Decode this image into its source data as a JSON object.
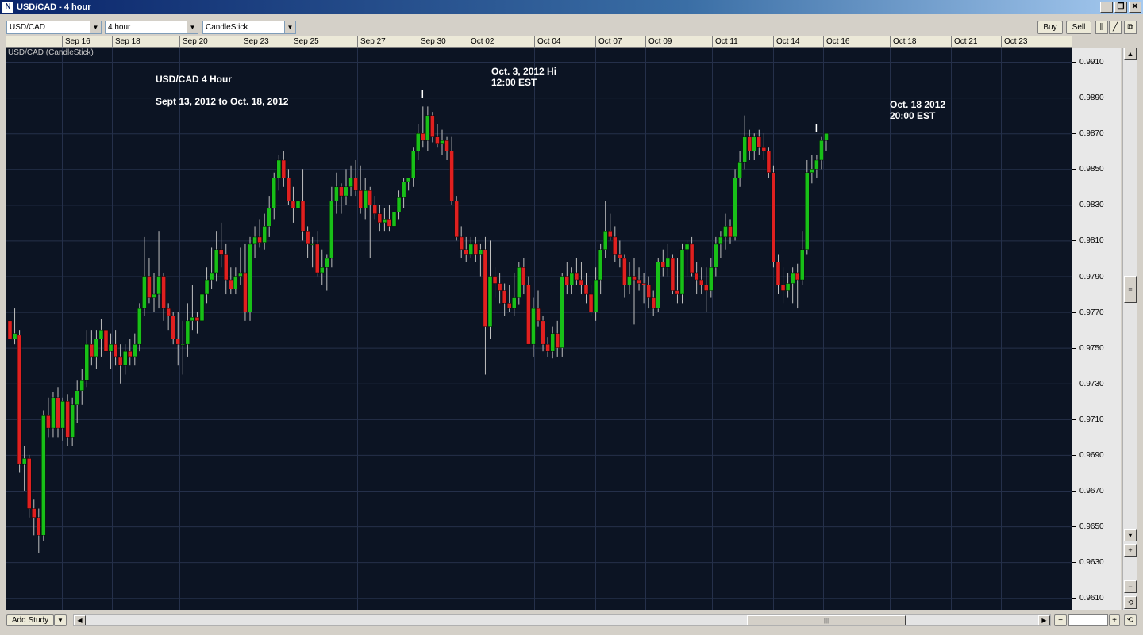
{
  "window": {
    "title": "USD/CAD - 4 hour",
    "icon": "app-logo-icon"
  },
  "toolbar": {
    "symbol": "USD/CAD",
    "interval": "4 hour",
    "chart_style": "CandleStick",
    "buy_label": "Buy",
    "sell_label": "Sell"
  },
  "chart_label": "USD/CAD (CandleStick)",
  "annotations": {
    "title_line1": "USD/CAD 4 Hour",
    "title_line2": "Sept 13, 2012 to Oct. 18, 2012",
    "high_line1": "Oct. 3, 2012 Hi",
    "high_line2": "12:00 EST",
    "last_line1": "Oct. 18 2012",
    "last_line2": "20:00 EST"
  },
  "bottom": {
    "add_study_label": "Add Study"
  },
  "colors": {
    "background": "#0c1423",
    "grid": "#25304a",
    "bull": "#18c018",
    "bear": "#e02020",
    "wick": "#bfbfbf"
  },
  "chart_data": {
    "type": "candlestick",
    "title": "USD/CAD 4 Hour",
    "subtitle": "Sept 13, 2012 to Oct. 18, 2012",
    "x_ticks": [
      "Sep 16",
      "Sep 18",
      "Sep 20",
      "Sep 23",
      "Sep 25",
      "Sep 27",
      "Sep 30",
      "Oct 02",
      "Oct 04",
      "Oct 07",
      "Oct 09",
      "Oct 11",
      "Oct 14",
      "Oct 16",
      "Oct 18",
      "Oct 21",
      "Oct 23"
    ],
    "y_ticks": [
      "0.9910",
      "0.9890",
      "0.9870",
      "0.9850",
      "0.9830",
      "0.9810",
      "0.9790",
      "0.9770",
      "0.9750",
      "0.9730",
      "0.9710",
      "0.9690",
      "0.9670",
      "0.9650",
      "0.9630",
      "0.9610"
    ],
    "ylim": [
      0.9603,
      0.9918
    ],
    "grid": true,
    "ohlc": [
      [
        0.9765,
        0.9775,
        0.9755,
        0.9755
      ],
      [
        0.9755,
        0.9772,
        0.9752,
        0.9758
      ],
      [
        0.9757,
        0.976,
        0.968,
        0.9685
      ],
      [
        0.9685,
        0.9695,
        0.967,
        0.9688
      ],
      [
        0.9688,
        0.969,
        0.9655,
        0.966
      ],
      [
        0.966,
        0.9665,
        0.9645,
        0.9655
      ],
      [
        0.9655,
        0.966,
        0.9635,
        0.9645
      ],
      [
        0.9645,
        0.9715,
        0.9642,
        0.9712
      ],
      [
        0.9712,
        0.9722,
        0.97,
        0.9705
      ],
      [
        0.9705,
        0.9725,
        0.97,
        0.9722
      ],
      [
        0.9722,
        0.9728,
        0.97,
        0.9705
      ],
      [
        0.9705,
        0.9722,
        0.9698,
        0.972
      ],
      [
        0.972,
        0.9724,
        0.9695,
        0.97
      ],
      [
        0.97,
        0.9722,
        0.9695,
        0.9718
      ],
      [
        0.9718,
        0.9732,
        0.9708,
        0.9726
      ],
      [
        0.9726,
        0.9738,
        0.9718,
        0.9732
      ],
      [
        0.9732,
        0.976,
        0.9728,
        0.9752
      ],
      [
        0.9752,
        0.976,
        0.974,
        0.9745
      ],
      [
        0.9745,
        0.976,
        0.9738,
        0.9755
      ],
      [
        0.9755,
        0.9766,
        0.9745,
        0.976
      ],
      [
        0.976,
        0.9762,
        0.974,
        0.9748
      ],
      [
        0.9748,
        0.9758,
        0.9738,
        0.9752
      ],
      [
        0.9752,
        0.976,
        0.974,
        0.9745
      ],
      [
        0.9745,
        0.9752,
        0.973,
        0.974
      ],
      [
        0.974,
        0.9752,
        0.9735,
        0.9748
      ],
      [
        0.9748,
        0.9755,
        0.974,
        0.9745
      ],
      [
        0.9745,
        0.9758,
        0.974,
        0.9752
      ],
      [
        0.9752,
        0.9775,
        0.9748,
        0.9772
      ],
      [
        0.9772,
        0.9812,
        0.9768,
        0.979
      ],
      [
        0.979,
        0.98,
        0.9775,
        0.9778
      ],
      [
        0.9778,
        0.9792,
        0.977,
        0.978
      ],
      [
        0.978,
        0.9815,
        0.9772,
        0.979
      ],
      [
        0.979,
        0.9792,
        0.9765,
        0.9772
      ],
      [
        0.9772,
        0.9775,
        0.976,
        0.9768
      ],
      [
        0.9768,
        0.977,
        0.9752,
        0.9755
      ],
      [
        0.9755,
        0.977,
        0.974,
        0.9752
      ],
      [
        0.9752,
        0.9765,
        0.9735,
        0.9752
      ],
      [
        0.9752,
        0.9775,
        0.9745,
        0.9765
      ],
      [
        0.9765,
        0.9785,
        0.976,
        0.9767
      ],
      [
        0.9767,
        0.977,
        0.9758,
        0.9765
      ],
      [
        0.9765,
        0.9782,
        0.976,
        0.978
      ],
      [
        0.978,
        0.9795,
        0.9775,
        0.9788
      ],
      [
        0.9788,
        0.9806,
        0.9783,
        0.9792
      ],
      [
        0.9792,
        0.9815,
        0.9787,
        0.9805
      ],
      [
        0.9805,
        0.982,
        0.9795,
        0.9802
      ],
      [
        0.9802,
        0.9808,
        0.978,
        0.9788
      ],
      [
        0.9788,
        0.9795,
        0.978,
        0.9783
      ],
      [
        0.9783,
        0.9795,
        0.978,
        0.979
      ],
      [
        0.979,
        0.9806,
        0.9785,
        0.9792
      ],
      [
        0.9792,
        0.9808,
        0.9765,
        0.977
      ],
      [
        0.977,
        0.9812,
        0.9765,
        0.9808
      ],
      [
        0.9808,
        0.9818,
        0.98,
        0.9812
      ],
      [
        0.9812,
        0.9822,
        0.9806,
        0.9809
      ],
      [
        0.9809,
        0.9825,
        0.9805,
        0.9818
      ],
      [
        0.9818,
        0.9835,
        0.9812,
        0.9828
      ],
      [
        0.9828,
        0.9848,
        0.9822,
        0.9845
      ],
      [
        0.9845,
        0.9858,
        0.9838,
        0.9855
      ],
      [
        0.9855,
        0.986,
        0.984,
        0.9845
      ],
      [
        0.9845,
        0.985,
        0.983,
        0.9832
      ],
      [
        0.9832,
        0.984,
        0.982,
        0.9828
      ],
      [
        0.9828,
        0.9845,
        0.9825,
        0.9832
      ],
      [
        0.9832,
        0.985,
        0.981,
        0.9815
      ],
      [
        0.9815,
        0.9818,
        0.98,
        0.9808
      ],
      [
        0.9808,
        0.9812,
        0.9795,
        0.9808
      ],
      [
        0.9808,
        0.9815,
        0.979,
        0.9792
      ],
      [
        0.9792,
        0.9805,
        0.9785,
        0.9795
      ],
      [
        0.9795,
        0.9802,
        0.9782,
        0.98
      ],
      [
        0.98,
        0.984,
        0.9795,
        0.9832
      ],
      [
        0.9832,
        0.9848,
        0.9825,
        0.984
      ],
      [
        0.984,
        0.9842,
        0.9825,
        0.9835
      ],
      [
        0.9835,
        0.985,
        0.983,
        0.984
      ],
      [
        0.984,
        0.9852,
        0.9835,
        0.9845
      ],
      [
        0.9845,
        0.9855,
        0.9835,
        0.9838
      ],
      [
        0.9838,
        0.9852,
        0.9825,
        0.9828
      ],
      [
        0.9828,
        0.9845,
        0.9822,
        0.9838
      ],
      [
        0.9838,
        0.984,
        0.98,
        0.983
      ],
      [
        0.983,
        0.9835,
        0.9822,
        0.9825
      ],
      [
        0.9825,
        0.983,
        0.9815,
        0.982
      ],
      [
        0.982,
        0.9828,
        0.9815,
        0.9822
      ],
      [
        0.9822,
        0.983,
        0.9815,
        0.9818
      ],
      [
        0.9818,
        0.9832,
        0.9812,
        0.9826
      ],
      [
        0.9826,
        0.9838,
        0.9822,
        0.9834
      ],
      [
        0.9834,
        0.9845,
        0.9828,
        0.9843
      ],
      [
        0.9843,
        0.9845,
        0.9838,
        0.9845
      ],
      [
        0.9845,
        0.9862,
        0.984,
        0.986
      ],
      [
        0.986,
        0.9875,
        0.9855,
        0.987
      ],
      [
        0.987,
        0.9885,
        0.9862,
        0.9866
      ],
      [
        0.9866,
        0.9885,
        0.986,
        0.988
      ],
      [
        0.988,
        0.9882,
        0.9865,
        0.9868
      ],
      [
        0.9868,
        0.9875,
        0.9862,
        0.9864
      ],
      [
        0.9864,
        0.9872,
        0.9858,
        0.9866
      ],
      [
        0.9866,
        0.9868,
        0.9855,
        0.986
      ],
      [
        0.986,
        0.9868,
        0.983,
        0.9832
      ],
      [
        0.9832,
        0.9835,
        0.981,
        0.9812
      ],
      [
        0.9812,
        0.9818,
        0.98,
        0.9805
      ],
      [
        0.9805,
        0.9812,
        0.9798,
        0.9802
      ],
      [
        0.9802,
        0.9812,
        0.98,
        0.9808
      ],
      [
        0.9808,
        0.9812,
        0.9798,
        0.9802
      ],
      [
        0.9802,
        0.9808,
        0.979,
        0.9805
      ],
      [
        0.9805,
        0.9812,
        0.9735,
        0.9762
      ],
      [
        0.9762,
        0.981,
        0.9755,
        0.979
      ],
      [
        0.979,
        0.9795,
        0.9778,
        0.9786
      ],
      [
        0.9786,
        0.9792,
        0.9775,
        0.9782
      ],
      [
        0.9782,
        0.9786,
        0.9768,
        0.9775
      ],
      [
        0.9775,
        0.9785,
        0.977,
        0.9772
      ],
      [
        0.9772,
        0.9792,
        0.9768,
        0.9778
      ],
      [
        0.9778,
        0.9798,
        0.9774,
        0.9795
      ],
      [
        0.9795,
        0.98,
        0.978,
        0.9785
      ],
      [
        0.9785,
        0.979,
        0.9752,
        0.9752
      ],
      [
        0.9752,
        0.9778,
        0.9745,
        0.9772
      ],
      [
        0.9772,
        0.9782,
        0.9762,
        0.9765
      ],
      [
        0.9765,
        0.9768,
        0.9748,
        0.9752
      ],
      [
        0.9752,
        0.9756,
        0.9745,
        0.9748
      ],
      [
        0.9748,
        0.9762,
        0.9744,
        0.9758
      ],
      [
        0.9758,
        0.9765,
        0.9745,
        0.975
      ],
      [
        0.975,
        0.9792,
        0.9745,
        0.979
      ],
      [
        0.979,
        0.9798,
        0.978,
        0.9785
      ],
      [
        0.9785,
        0.9795,
        0.978,
        0.9792
      ],
      [
        0.9792,
        0.98,
        0.9785,
        0.9788
      ],
      [
        0.9788,
        0.9798,
        0.978,
        0.9785
      ],
      [
        0.9785,
        0.9792,
        0.9775,
        0.978
      ],
      [
        0.978,
        0.9785,
        0.9768,
        0.977
      ],
      [
        0.977,
        0.9795,
        0.9765,
        0.9788
      ],
      [
        0.9788,
        0.9808,
        0.978,
        0.9805
      ],
      [
        0.9805,
        0.9832,
        0.98,
        0.9815
      ],
      [
        0.9815,
        0.9825,
        0.981,
        0.9812
      ],
      [
        0.9812,
        0.9818,
        0.9798,
        0.9802
      ],
      [
        0.9802,
        0.981,
        0.9795,
        0.98
      ],
      [
        0.98,
        0.9802,
        0.9778,
        0.9785
      ],
      [
        0.9785,
        0.9798,
        0.978,
        0.979
      ],
      [
        0.979,
        0.98,
        0.9763,
        0.9788
      ],
      [
        0.9788,
        0.9795,
        0.9782,
        0.9786
      ],
      [
        0.9786,
        0.9792,
        0.9775,
        0.9785
      ],
      [
        0.9785,
        0.979,
        0.9772,
        0.9778
      ],
      [
        0.9778,
        0.9782,
        0.9768,
        0.9772
      ],
      [
        0.9772,
        0.98,
        0.977,
        0.9798
      ],
      [
        0.9798,
        0.9805,
        0.979,
        0.9795
      ],
      [
        0.9795,
        0.9808,
        0.979,
        0.98
      ],
      [
        0.98,
        0.9802,
        0.978,
        0.9782
      ],
      [
        0.9782,
        0.98,
        0.9775,
        0.978
      ],
      [
        0.978,
        0.9808,
        0.9775,
        0.9805
      ],
      [
        0.9805,
        0.981,
        0.979,
        0.9808
      ],
      [
        0.9808,
        0.9812,
        0.979,
        0.9792
      ],
      [
        0.9792,
        0.9798,
        0.978,
        0.9788
      ],
      [
        0.9788,
        0.9795,
        0.978,
        0.9785
      ],
      [
        0.9785,
        0.9795,
        0.977,
        0.9782
      ],
      [
        0.9782,
        0.98,
        0.9778,
        0.9795
      ],
      [
        0.9795,
        0.9812,
        0.979,
        0.9808
      ],
      [
        0.9808,
        0.9815,
        0.98,
        0.9812
      ],
      [
        0.9812,
        0.9825,
        0.9805,
        0.9818
      ],
      [
        0.9818,
        0.9822,
        0.9808,
        0.9812
      ],
      [
        0.9812,
        0.985,
        0.981,
        0.9845
      ],
      [
        0.9845,
        0.986,
        0.984,
        0.9854
      ],
      [
        0.9854,
        0.988,
        0.985,
        0.9868
      ],
      [
        0.9868,
        0.9872,
        0.9855,
        0.986
      ],
      [
        0.986,
        0.987,
        0.9855,
        0.9868
      ],
      [
        0.9868,
        0.9872,
        0.9858,
        0.9862
      ],
      [
        0.9862,
        0.987,
        0.9855,
        0.986
      ],
      [
        0.986,
        0.9862,
        0.9845,
        0.9848
      ],
      [
        0.9848,
        0.9852,
        0.9795,
        0.9798
      ],
      [
        0.9798,
        0.9802,
        0.978,
        0.9785
      ],
      [
        0.9785,
        0.9795,
        0.9775,
        0.9782
      ],
      [
        0.9782,
        0.9792,
        0.9778,
        0.9786
      ],
      [
        0.9786,
        0.9795,
        0.9775,
        0.9792
      ],
      [
        0.9792,
        0.9797,
        0.9772,
        0.9788
      ],
      [
        0.9788,
        0.9815,
        0.9785,
        0.9805
      ],
      [
        0.9805,
        0.9855,
        0.9802,
        0.9848
      ],
      [
        0.9848,
        0.9858,
        0.9842,
        0.985
      ],
      [
        0.985,
        0.9858,
        0.9845,
        0.9855
      ],
      [
        0.9855,
        0.9868,
        0.985,
        0.9866
      ],
      [
        0.9866,
        0.987,
        0.986,
        0.987
      ]
    ]
  }
}
